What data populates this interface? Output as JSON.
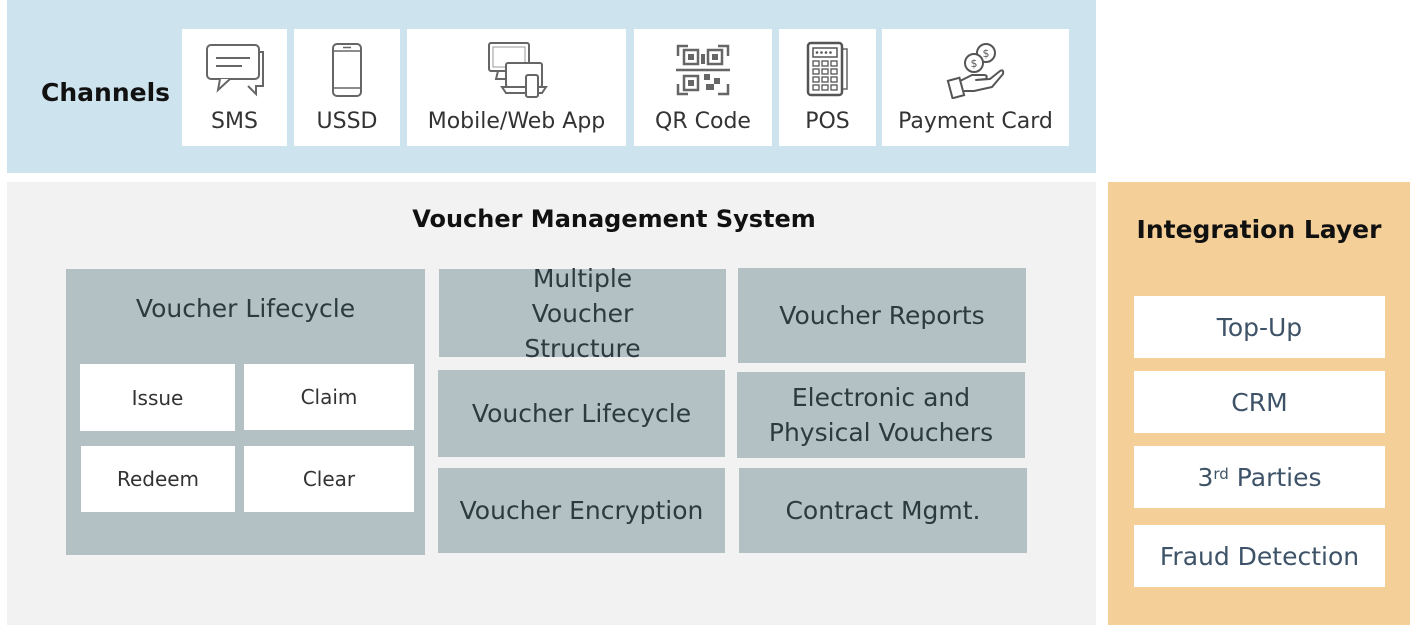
{
  "channels": {
    "title": "Channels",
    "items": [
      {
        "label": "SMS",
        "icon": "sms-chat-icon"
      },
      {
        "label": "USSD",
        "icon": "mobile-phone-icon"
      },
      {
        "label": "Mobile/Web App",
        "icon": "devices-icon"
      },
      {
        "label": "QR Code",
        "icon": "qr-code-icon"
      },
      {
        "label": "POS",
        "icon": "pos-terminal-icon"
      },
      {
        "label": "Payment Card",
        "icon": "hand-coins-icon"
      }
    ]
  },
  "vms": {
    "title": "Voucher Management System",
    "lifecycle_panel": {
      "title": "Voucher Lifecycle",
      "actions": [
        "Issue",
        "Claim",
        "Redeem",
        "Clear"
      ]
    },
    "modules": [
      {
        "label": "Multiple Voucher Structure"
      },
      {
        "label": "Voucher Reports"
      },
      {
        "label": "Voucher Lifecycle"
      },
      {
        "label": "Electronic and Physical Vouchers"
      },
      {
        "label": "Voucher Encryption"
      },
      {
        "label": "Contract Mgmt."
      }
    ]
  },
  "integration": {
    "title": "Integration Layer",
    "items": [
      {
        "label": "Top-Up"
      },
      {
        "label": "CRM"
      },
      {
        "label_base": "3",
        "label_sup": "rd",
        "label_rest": " Parties"
      },
      {
        "label": "Fraud Detection"
      }
    ]
  },
  "colors": {
    "channels_bg": "#cde3ed",
    "vms_bg": "#f2f2f2",
    "module_bg": "#b3c1c4",
    "integration_bg": "#f5cf98",
    "integration_text": "#3e5368"
  }
}
